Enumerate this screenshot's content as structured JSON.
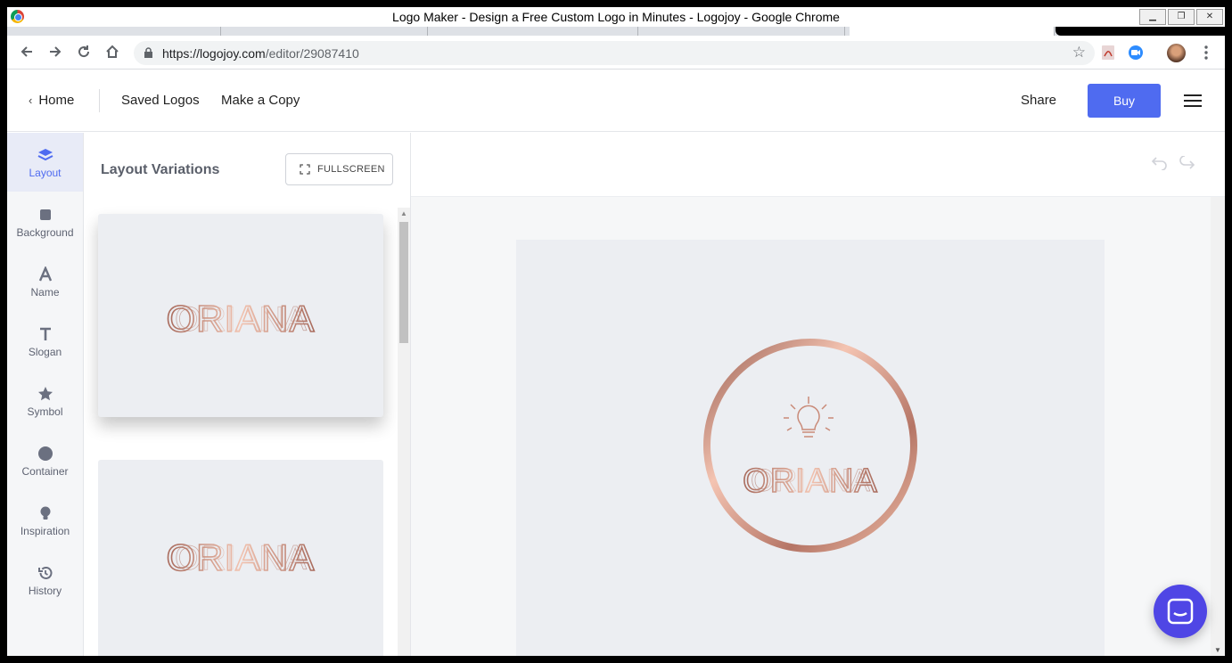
{
  "window": {
    "title": "Logo Maker - Design a Free Custom Logo in Minutes - Logojoy - Google Chrome",
    "buttons": [
      "minimize",
      "restore",
      "close"
    ]
  },
  "browser": {
    "url_host": "https://logojoy.com",
    "url_path": "/editor/29087410",
    "nav_icons": [
      "back-icon",
      "forward-icon",
      "reload-icon",
      "home-icon"
    ],
    "extensions": [
      "bookmark-star-icon",
      "pdf-icon",
      "zoom-icon",
      "profile-avatar",
      "menu-dots-icon"
    ]
  },
  "topnav": {
    "home": "Home",
    "saved": "Saved Logos",
    "copy": "Make a Copy",
    "share": "Share",
    "buy": "Buy"
  },
  "sidebar": {
    "items": [
      {
        "label": "Layout",
        "icon": "layers-icon",
        "active": true
      },
      {
        "label": "Background",
        "icon": "square-icon"
      },
      {
        "label": "Name",
        "icon": "letter-a-icon"
      },
      {
        "label": "Slogan",
        "icon": "letter-t-icon"
      },
      {
        "label": "Symbol",
        "icon": "star-icon"
      },
      {
        "label": "Container",
        "icon": "circle-icon"
      },
      {
        "label": "Inspiration",
        "icon": "lightbulb-icon"
      },
      {
        "label": "History",
        "icon": "history-icon"
      }
    ]
  },
  "panel": {
    "title": "Layout Variations",
    "fullscreen": "FULLSCREEN"
  },
  "logo": {
    "name": "ORIANA",
    "colors": {
      "dark": "#a86a5c",
      "mid": "#c98a78",
      "light": "#f2c3b0"
    }
  },
  "colors": {
    "accent": "#4f6bf0",
    "chat": "#4f46e5"
  }
}
